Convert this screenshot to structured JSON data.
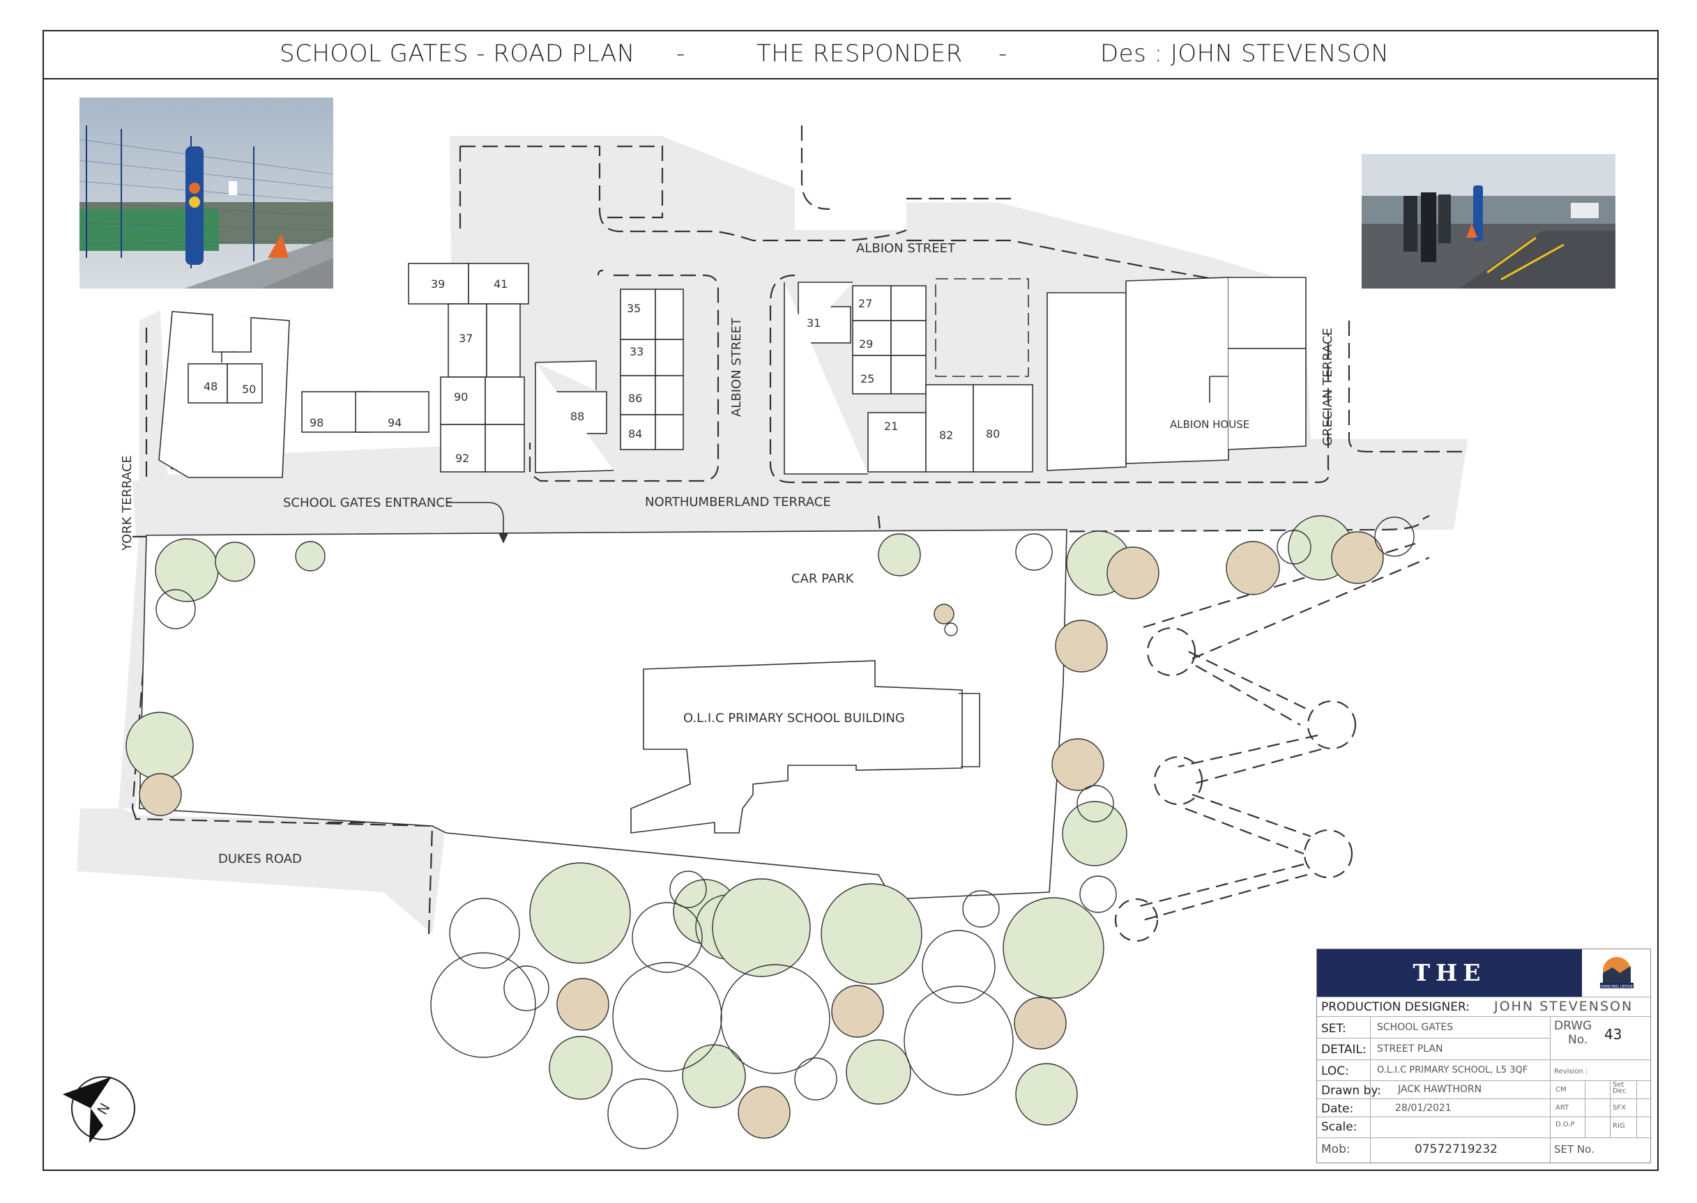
{
  "header": {
    "title": "SCHOOL GATES - ROAD PLAN",
    "sep1": "-",
    "production": "THE RESPONDER",
    "sep2": "-",
    "designer": "Des : JOHN STEVENSON"
  },
  "map_labels": {
    "albion_street_top": "ALBION STREET",
    "albion_street_side": "ALBION STREET",
    "grecian_terrace": "GRECIAN TERRACE",
    "york_terrace": "YORK TERRACE",
    "northumberland_terrace": "NORTHUMBERLAND TERRACE",
    "school_gates_entrance": "SCHOOL GATES ENTRANCE",
    "car_park": "CAR PARK",
    "school_building": "O.L.I.C PRIMARY SCHOOL BUILDING",
    "dukes_road": "DUKES ROAD",
    "albion_house": "ALBION HOUSE",
    "north_marker": "N"
  },
  "house_numbers": [
    "39",
    "41",
    "37",
    "90",
    "92",
    "98",
    "94",
    "48",
    "50",
    "35",
    "33",
    "86",
    "84",
    "88",
    "31",
    "27",
    "29",
    "25",
    "21",
    "82",
    "80"
  ],
  "title_block": {
    "production": "THE RESPONDER",
    "designer_label": "PRODUCTION DESIGNER:",
    "designer": "JOHN STEVENSON",
    "set_label": "SET:",
    "set": "SCHOOL GATES",
    "detail_label": "DETAIL:",
    "detail": "STREET PLAN",
    "loc_label": "LOC:",
    "loc": "O.L.I.C PRIMARY SCHOOL, L5 3QF",
    "drawn_label": "Drawn by:",
    "drawn": "JACK HAWTHORN",
    "date_label": "Date:",
    "date": "28/01/2021",
    "scale_label": "Scale:",
    "mob_label": "Mob:",
    "mob": "07572719232",
    "drwg_label": "DRWG",
    "no_label": "No.",
    "drwg_no": "43",
    "revision_label": "Revision :",
    "cm": "CM",
    "set_dec": "Set Dec",
    "art": "ART",
    "sfx": "SFX",
    "dop": "D.O.P",
    "rig": "RIG",
    "set_no_label": "SET No.",
    "logo_text": "DANCING LEDGE"
  },
  "colors": {
    "road": "#ebebeb",
    "tree_green": "#dfe9d0",
    "tree_brown": "#e2d3b8",
    "title_navy": "#1e2a5a"
  }
}
